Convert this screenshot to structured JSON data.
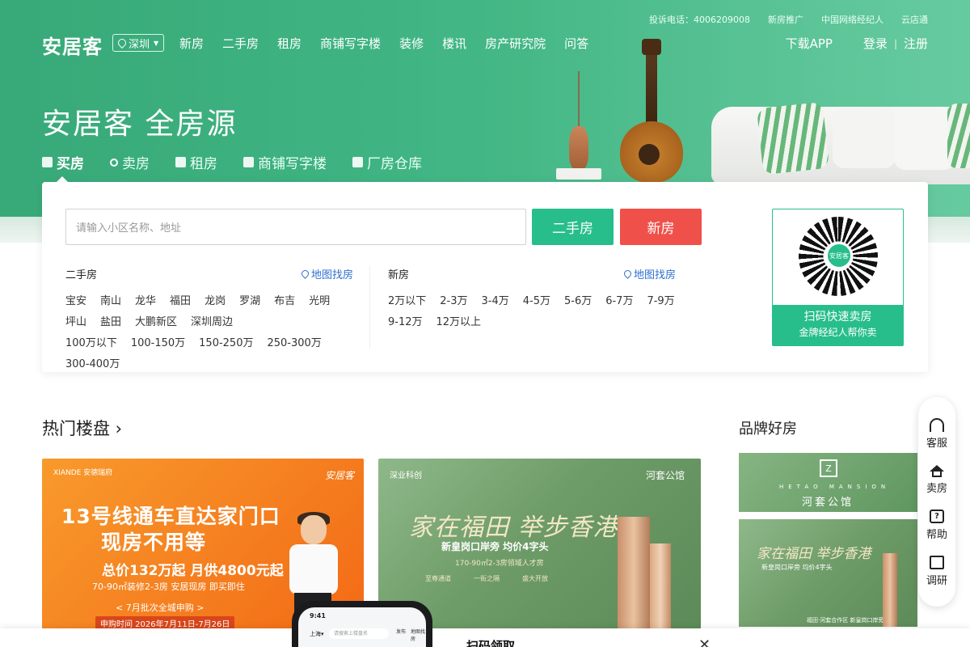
{
  "topbar": {
    "items": [
      "投诉电话：4006209008",
      "新房推广",
      "中国网络经纪人",
      "云店通"
    ]
  },
  "header": {
    "logo": "安居客",
    "city": "深圳",
    "nav": [
      "新房",
      "二手房",
      "租房",
      "商铺写字楼",
      "装修",
      "楼讯",
      "房产研究院",
      "问答"
    ],
    "download": "下载APP",
    "login": "登录",
    "separator": "|",
    "register": "注册"
  },
  "hero": {
    "title": "安居客 全房源",
    "tabs": [
      "买房",
      "卖房",
      "租房",
      "商铺写字楼",
      "厂房仓库"
    ]
  },
  "search": {
    "placeholder": "请输入小区名称、地址",
    "btn_second": "二手房",
    "btn_new": "新房",
    "second_col": {
      "title": "二手房",
      "map": "地图找房",
      "rows": [
        [
          "宝安",
          "南山",
          "龙华",
          "福田",
          "龙岗",
          "罗湖",
          "布吉",
          "光明"
        ],
        [
          "坪山",
          "盐田",
          "大鹏新区",
          "深圳周边"
        ],
        [
          "100万以下",
          "100-150万",
          "150-250万",
          "250-300万",
          "300-400万"
        ]
      ]
    },
    "new_col": {
      "title": "新房",
      "map": "地图找房",
      "rows": [
        [
          "2万以下",
          "2-3万",
          "3-4万",
          "4-5万",
          "5-6万",
          "6-7万",
          "7-9万"
        ],
        [
          "9-12万",
          "12万以上"
        ]
      ]
    },
    "qr": {
      "center": "安居客",
      "line1": "扫码快速卖房",
      "line2": "金牌经纪人帮你卖"
    }
  },
  "hot": {
    "title": "热门楼盘 ›",
    "brand_title": "品牌好房",
    "banner1": {
      "brand": "XIANDE 安德瑞府",
      "corner": "安居客",
      "headline1": "13号线通车直达家门口",
      "headline2": "现房不用等",
      "price": "总价132万起 月供4800元起",
      "sub": "70-90㎡装修2-3房 安居现房 即买即住",
      "batch": "< 7月批次全城申购 >",
      "time": "申购时间 2026年7月11日-7月26日"
    },
    "banner2": {
      "logo": "深业科创",
      "brand": "河套公馆",
      "headline": "家在福田 举步香港",
      "sub": "新皇岗口岸旁 均价4字头",
      "info": "170-90㎡2-3房领域人才房",
      "tags": [
        "至尊通道",
        "一街之隔",
        "盛大开放"
      ]
    },
    "brand1": {
      "logo": "Z",
      "en": "HETAO MANSION",
      "cn": "河套公馆"
    },
    "brand2": {
      "headline": "家在福田 举步香港",
      "sub": "新皇岗口岸旁 均价4字头",
      "foot": "福田·河套合作区 新皇岗口岸旁"
    }
  },
  "float_bar": {
    "items": [
      "客服",
      "卖房",
      "帮助",
      "调研"
    ],
    "help_glyph": "?"
  },
  "promo": {
    "phone_time": "9:41",
    "phone_city": "上海▾",
    "phone_search": "请搜索上楼盘名",
    "phone_ic1": "发布",
    "phone_ic2": "地图找房",
    "text": "扫码领取",
    "close": "✕"
  }
}
